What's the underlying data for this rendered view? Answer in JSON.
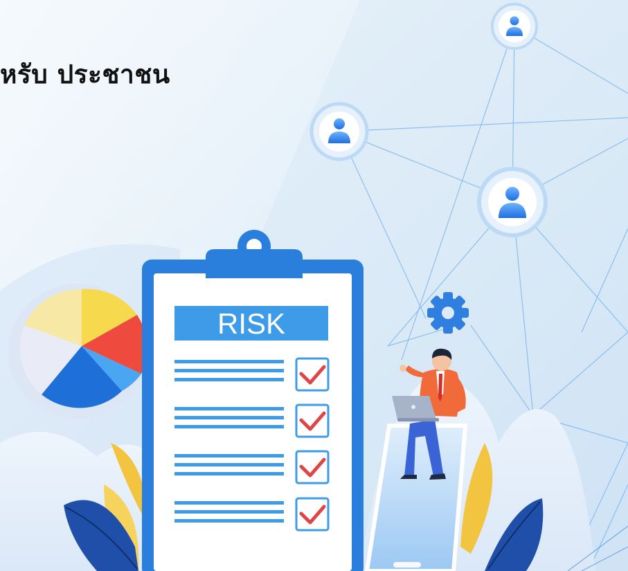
{
  "heading": {
    "text": "หรับ ประชาชน"
  },
  "clipboard": {
    "label": "RISK",
    "checklist_rows": 4,
    "checked_rows": 4
  },
  "colors": {
    "background": "#dcebf7",
    "accent_blue": "#2f7fe0",
    "clipboard_border": "#2b7fdc",
    "banner": "#3e9be8",
    "check_red": "#e04545",
    "pie_yellow": "#f6d94c",
    "pie_red": "#ee4a3e",
    "pie_blue": "#1f6fd8",
    "leaf_yellow": "#f2c440",
    "leaf_dark_blue": "#1f4fa8"
  },
  "icons": [
    "person-icon",
    "person-icon",
    "person-icon",
    "gear-icon",
    "checkmark-icon",
    "pie-chart-graphic",
    "laptop-icon"
  ]
}
